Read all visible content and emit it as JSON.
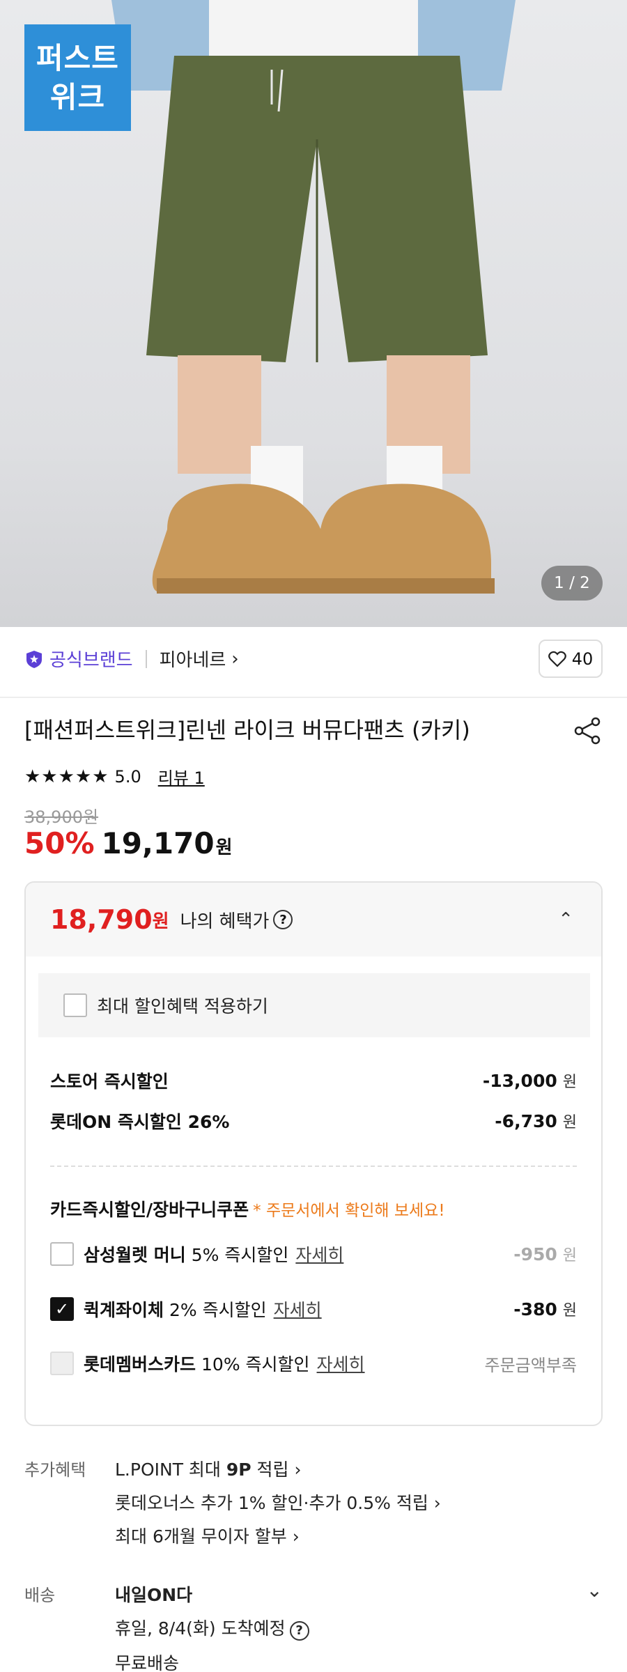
{
  "hero": {
    "badge_text": "퍼스트\n위크",
    "pager": "1 / 2"
  },
  "brand": {
    "official_label": "공식브랜드",
    "name": "피아네르",
    "like_count": "40"
  },
  "product": {
    "title": "[패션퍼스트위크]린넨 라이크 버뮤다팬츠 (카키)",
    "rating": "5.0",
    "review_link": "리뷰 1",
    "original_price": "38,900원",
    "discount_rate": "50%",
    "sale_price": "19,170",
    "currency": "원"
  },
  "benefit": {
    "my_price": "18,790",
    "currency": "원",
    "my_price_label": "나의 혜택가",
    "max_discount_label": "최대 할인혜택 적용하기",
    "store_discount_label": "스토어 즉시할인",
    "store_discount_amount": "-13,000",
    "lotteon_discount_label": "롯데ON 즉시할인 26%",
    "lotteon_discount_amount": "-6,730",
    "card_section_title": "카드즉시할인/장바구니쿠폰",
    "card_section_note": "* 주문서에서 확인해 보세요!",
    "cards": [
      {
        "name": "삼성월렛 머니",
        "desc": "5% 즉시할인",
        "detail": "자세히",
        "amount": "-950",
        "state": "unchecked"
      },
      {
        "name": "퀵계좌이체",
        "desc": "2% 즉시할인",
        "detail": "자세히",
        "amount": "-380",
        "state": "checked"
      },
      {
        "name": "롯데멤버스카드",
        "desc": "10% 즉시할인",
        "detail": "자세히",
        "status": "주문금액부족",
        "state": "disabled"
      }
    ]
  },
  "extra": {
    "label": "추가혜택",
    "items": [
      {
        "pre": "L.POINT 최대 ",
        "bold": "9P",
        "post": " 적립 ›"
      },
      {
        "pre": "롯데오너스 추가 1% 할인·추가 0.5% 적립 ›",
        "bold": "",
        "post": ""
      },
      {
        "pre": "최대 6개월 무이자 할부 ›",
        "bold": "",
        "post": ""
      }
    ]
  },
  "shipping": {
    "label": "배송",
    "title": "내일ON다",
    "eta": "휴일, 8/4(화) 도착예정",
    "fee": "무료배송"
  }
}
